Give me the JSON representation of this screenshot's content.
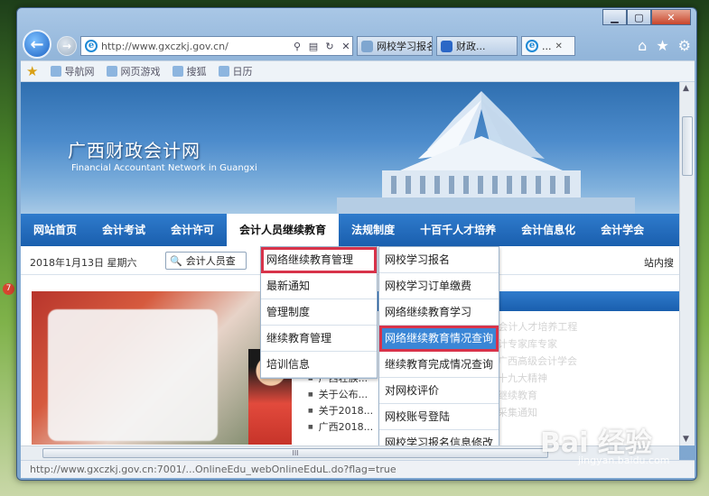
{
  "browser": {
    "address": "http://www.gxczkj.gov.cn/",
    "tabs": [
      {
        "label": "网校学习报名",
        "active": false
      },
      {
        "label": "财政...",
        "active": false
      },
      {
        "label": "...",
        "active": true
      }
    ],
    "favorites": [
      "导航网",
      "网页游戏",
      "搜狐",
      "日历"
    ],
    "status_text": "http://www.gxczkj.gov.cn:7001/...OnlineEdu_webOnlineEduL.do?flag=true",
    "scroll_grip": "III"
  },
  "site": {
    "title": "广西财政会计网",
    "subtitle": "Financial Accountant Network in Guangxi"
  },
  "nav": {
    "items": [
      "网站首页",
      "会计考试",
      "会计许可",
      "会计人员继续教育",
      "法规制度",
      "十百千人才培养",
      "会计信息化",
      "会计学会"
    ]
  },
  "date_strip": {
    "date": "2018年1月13日  星期六",
    "search_text": "会计人员查",
    "site_search": "站内搜"
  },
  "menu_left": [
    {
      "label": "网络继续教育管理",
      "highlight": true
    },
    {
      "label": "最新通知",
      "highlight": false
    },
    {
      "label": "管理制度",
      "highlight": false
    },
    {
      "label": "继续教育管理",
      "highlight": false
    },
    {
      "label": "培训信息",
      "highlight": false
    }
  ],
  "menu_right": [
    {
      "label": "网校学习报名",
      "highlight": false
    },
    {
      "label": "网校学习订单缴费",
      "highlight": false
    },
    {
      "label": "网络继续教育学习",
      "highlight": false
    },
    {
      "label": "网络继续教育情况查询",
      "highlight": true
    },
    {
      "label": "继续教育完成情况查询",
      "highlight": false
    },
    {
      "label": "对网校评价",
      "highlight": false
    },
    {
      "label": "网校账号登陆",
      "highlight": false
    },
    {
      "label": "网校学习报名信息修改",
      "highlight": false
    }
  ],
  "news": [
    "广西壮族...",
    "关于公布...",
    "关于2018...",
    "广西2018..."
  ],
  "news_faded": [
    "广西“十百千”优秀会计人才培养工程",
    "选聘第二届广西会计专家库专家",
    "会计技术资格考试广西高级会计学会",
    "做好学习贯彻党的十九大精神",
    "会计从业资格人员继续教育",
    "广西会计人员信息采集通知",
    "报名有关问题答复"
  ],
  "watermark": {
    "main": "Bai 经验",
    "sub": "jingyan.baidu.com"
  },
  "badge": "7",
  "colors": {
    "nav_blue": "#1a5fae",
    "highlight_red": "#d8334a",
    "selected_blue": "#3a86d6"
  }
}
